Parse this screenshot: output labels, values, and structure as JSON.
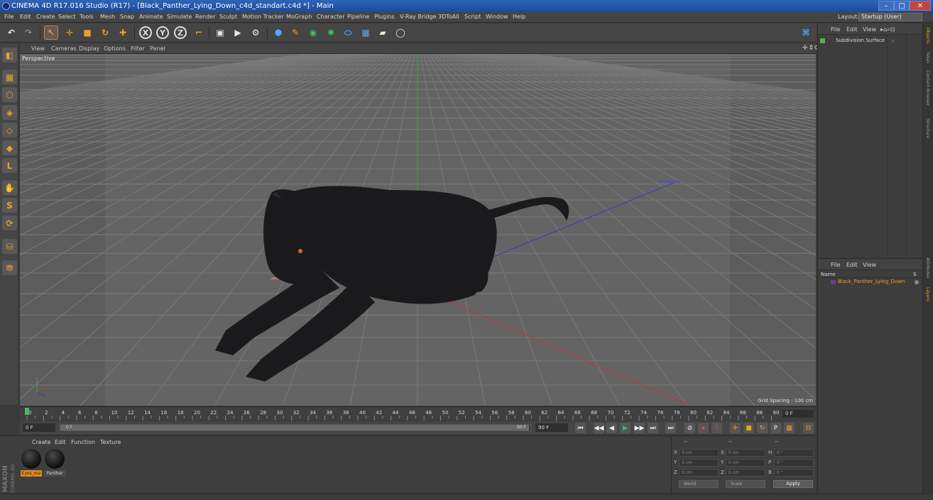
{
  "window": {
    "title": "CINEMA 4D R17.016 Studio (R17) - [Black_Panther_Lying_Down_c4d_standart.c4d *] - Main",
    "controls": [
      "–",
      "□",
      "✕"
    ]
  },
  "menu": {
    "items": [
      "File",
      "Edit",
      "Create",
      "Select",
      "Tools",
      "Mesh",
      "Snap",
      "Animate",
      "Simulate",
      "Render",
      "Sculpt",
      "Motion Tracker",
      "MoGraph",
      "Character",
      "Pipeline",
      "Plugins",
      "V-Ray Bridge",
      "3DToAll",
      "Script",
      "Window",
      "Help"
    ],
    "layout_label": "Layout:",
    "layout_value": "Startup (User)"
  },
  "toolbar": {
    "undo_icon": "↶",
    "redo_icon": "↷",
    "select_icon": "↖",
    "move_icon": "✛",
    "scale_icon": "■",
    "rotate_icon": "↻",
    "recent_icon": "✚",
    "x_axis": "X",
    "y_axis": "Y",
    "z_axis": "Z",
    "coord_icon": "⌐",
    "render_region_icon": "▣",
    "render_view_icon": "▶",
    "render_settings_icon": "⚙",
    "cube_icon": "⬢",
    "pen_icon": "✎",
    "subdiv_icon": "◉",
    "cloner_icon": "✺",
    "deformer_icon": "⬭",
    "floor_icon": "▦",
    "camera_icon": "▰",
    "light_icon": "◯",
    "python_icon": "⌘"
  },
  "lefttools": [
    "◧",
    "▦",
    "⬡",
    "◈",
    "◇",
    "◆",
    "L",
    "✋",
    "S",
    "⟳",
    "⛁",
    "⛃"
  ],
  "viewport": {
    "menu": [
      "View",
      "Cameras",
      "Display",
      "Options",
      "Filter",
      "Panel"
    ],
    "nav_icons": "✛⇕⟳▢",
    "label": "Perspective",
    "grid_spacing": "Grid Spacing : 100 cm"
  },
  "timeline": {
    "ticks": [
      "0",
      "2",
      "4",
      "6",
      "8",
      "10",
      "12",
      "14",
      "16",
      "18",
      "20",
      "22",
      "24",
      "26",
      "28",
      "30",
      "32",
      "34",
      "36",
      "38",
      "40",
      "42",
      "44",
      "46",
      "48",
      "50",
      "52",
      "54",
      "56",
      "58",
      "60",
      "62",
      "64",
      "66",
      "68",
      "70",
      "72",
      "74",
      "76",
      "78",
      "80",
      "82",
      "84",
      "86",
      "88",
      "90"
    ],
    "current_frame": "0 F"
  },
  "transport": {
    "start_field": "0 F",
    "range_start": "0 F",
    "range_end": "90 F",
    "end_field": "90 F",
    "buttons": [
      "⏮",
      "◀◀",
      "◀",
      "▶",
      "▶▶",
      "⏭",
      "⏭"
    ],
    "key_buttons": [
      "⊘",
      "⏺",
      "?",
      "✛",
      "■",
      "↻",
      "P",
      "▦",
      "⊟"
    ]
  },
  "materials": {
    "menu": [
      "Create",
      "Edit",
      "Function",
      "Texture"
    ],
    "items": [
      {
        "name": "Eyes_ma",
        "selected": true
      },
      {
        "name": "Panther",
        "selected": false
      }
    ],
    "logo_line1": "MAXON",
    "logo_line2": "CINEMA 4D"
  },
  "coordinates": {
    "header_dashes": [
      "--",
      "--",
      "--"
    ],
    "rows": [
      {
        "l1": "X",
        "v1": "0 cm",
        "l2": "X",
        "v2": "0 cm",
        "l3": "H",
        "v3": "0 °"
      },
      {
        "l1": "Y",
        "v1": "0 cm",
        "l2": "Y",
        "v2": "0 cm",
        "l3": "P",
        "v3": "0 °"
      },
      {
        "l1": "Z",
        "v1": "0 cm",
        "l2": "Z",
        "v2": "0 cm",
        "l3": "B",
        "v3": "0 °"
      }
    ],
    "mode": "World",
    "transform": "Scale",
    "apply": "Apply"
  },
  "objects": {
    "menu": [
      "File",
      "Edit",
      "View"
    ],
    "icons": "▸⌂⌕⊡",
    "item": "Subdivision Surface",
    "flags": "✓"
  },
  "layers": {
    "menu": [
      "File",
      "Edit",
      "View"
    ],
    "col_name": "Name",
    "col_s": "S",
    "item": "Black_Panther_Lying_Down"
  },
  "side_tabs": [
    "Objects",
    "Takes",
    "Content Browser",
    "Structure",
    "Attributes",
    "Layers"
  ],
  "colors": {
    "accent": "#f0a020",
    "viewport_bg": "#5d5d5d",
    "titlebar": "#2e64b8",
    "panther": "#1a1a1c"
  }
}
